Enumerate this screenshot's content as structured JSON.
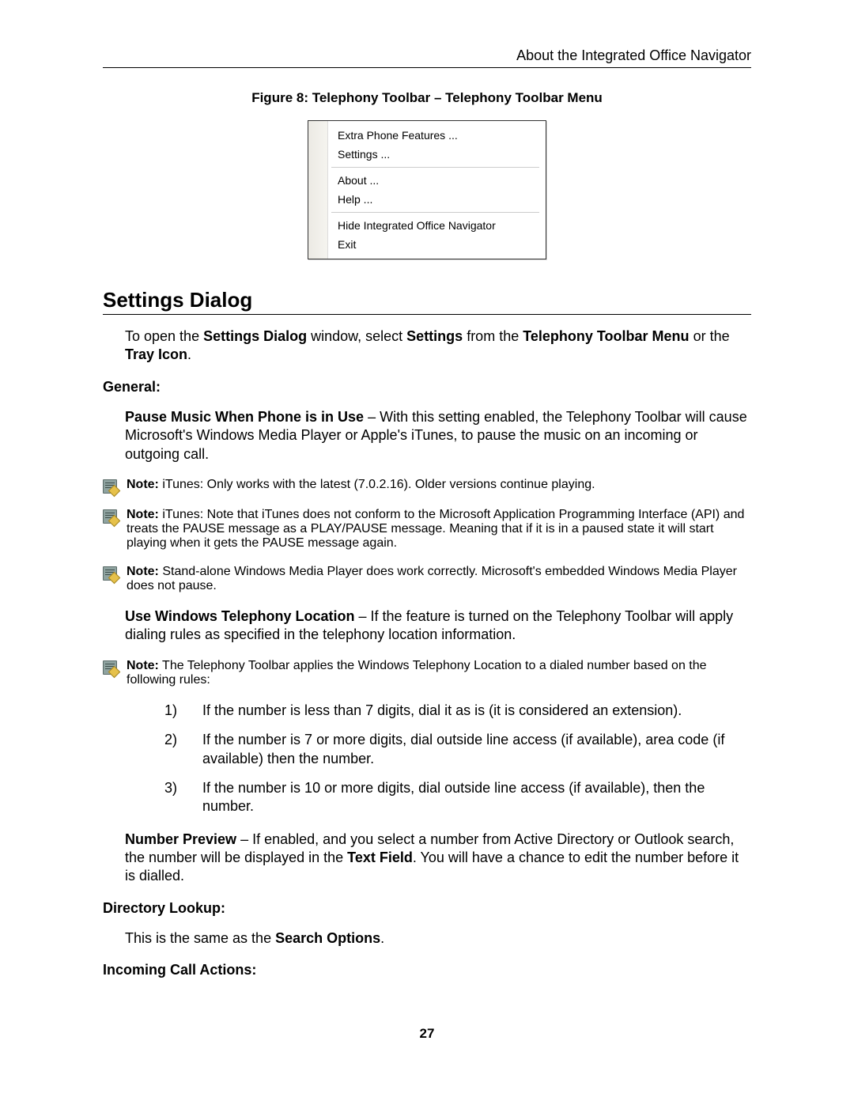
{
  "header": {
    "running_head": "About the Integrated Office Navigator"
  },
  "figure": {
    "caption": "Figure 8: Telephony Toolbar – Telephony Toolbar Menu",
    "menu_items": [
      "Extra Phone Features ...",
      "Settings ...",
      "About ...",
      "Help ...",
      "Hide Integrated Office Navigator",
      "Exit"
    ]
  },
  "section": {
    "title": "Settings Dialog",
    "intro_parts": {
      "p1": "To open the ",
      "b1": "Settings Dialog",
      "p2": " window, select ",
      "b2": "Settings",
      "p3": " from the ",
      "b3": "Telephony Toolbar Menu",
      "p4": " or the ",
      "b4": "Tray Icon",
      "p5": "."
    },
    "general_label": "General:",
    "pause_music": {
      "b": "Pause Music When Phone is in Use",
      "rest": " – With this setting enabled, the Telephony Toolbar will cause Microsoft's Windows Media Player or Apple's iTunes, to pause the music on an incoming or outgoing call."
    },
    "notes": {
      "n1": {
        "label": "Note:",
        "text": " iTunes: Only works with the latest (7.0.2.16).  Older versions continue playing."
      },
      "n2": {
        "label": "Note:",
        "text": " iTunes: Note that iTunes does not conform to the Microsoft Application Programming Interface (API) and treats the PAUSE message as a PLAY/PAUSE message.  Meaning that if it is in a paused state it will start playing when it gets the PAUSE message again."
      },
      "n3": {
        "label": "Note:",
        "text": " Stand-alone Windows Media Player does work correctly.  Microsoft's embedded Windows Media Player does not pause."
      }
    },
    "use_win_tel": {
      "b": "Use Windows Telephony Location",
      "rest": " – If the feature is turned on the Telephony Toolbar will apply dialing rules as specified in the telephony location information."
    },
    "note4": {
      "label": "Note:",
      "text": " The Telephony Toolbar applies the Windows Telephony Location to a dialed number based on the following rules:"
    },
    "rules": [
      {
        "num": "1)",
        "text": "If the number is less than 7 digits, dial it as is (it is considered an extension)."
      },
      {
        "num": "2)",
        "text": "If the number is 7 or more digits, dial outside line access (if available), area code (if available) then the number."
      },
      {
        "num": "3)",
        "text": "If the number is 10 or more digits, dial outside line access (if available), then the number."
      }
    ],
    "number_preview": {
      "b1": "Number Preview",
      "mid": " – If enabled, and you select a number from Active Directory or Outlook search, the number will be displayed in the ",
      "b2": "Text Field",
      "end": ". You will have a chance to edit the number before it is dialled."
    },
    "dir_lookup_label": "Directory Lookup:",
    "dir_lookup_text_pre": "This is the same as the ",
    "dir_lookup_text_b": "Search Options",
    "dir_lookup_text_post": ".",
    "incoming_label": "Incoming Call Actions:"
  },
  "page_number": "27"
}
